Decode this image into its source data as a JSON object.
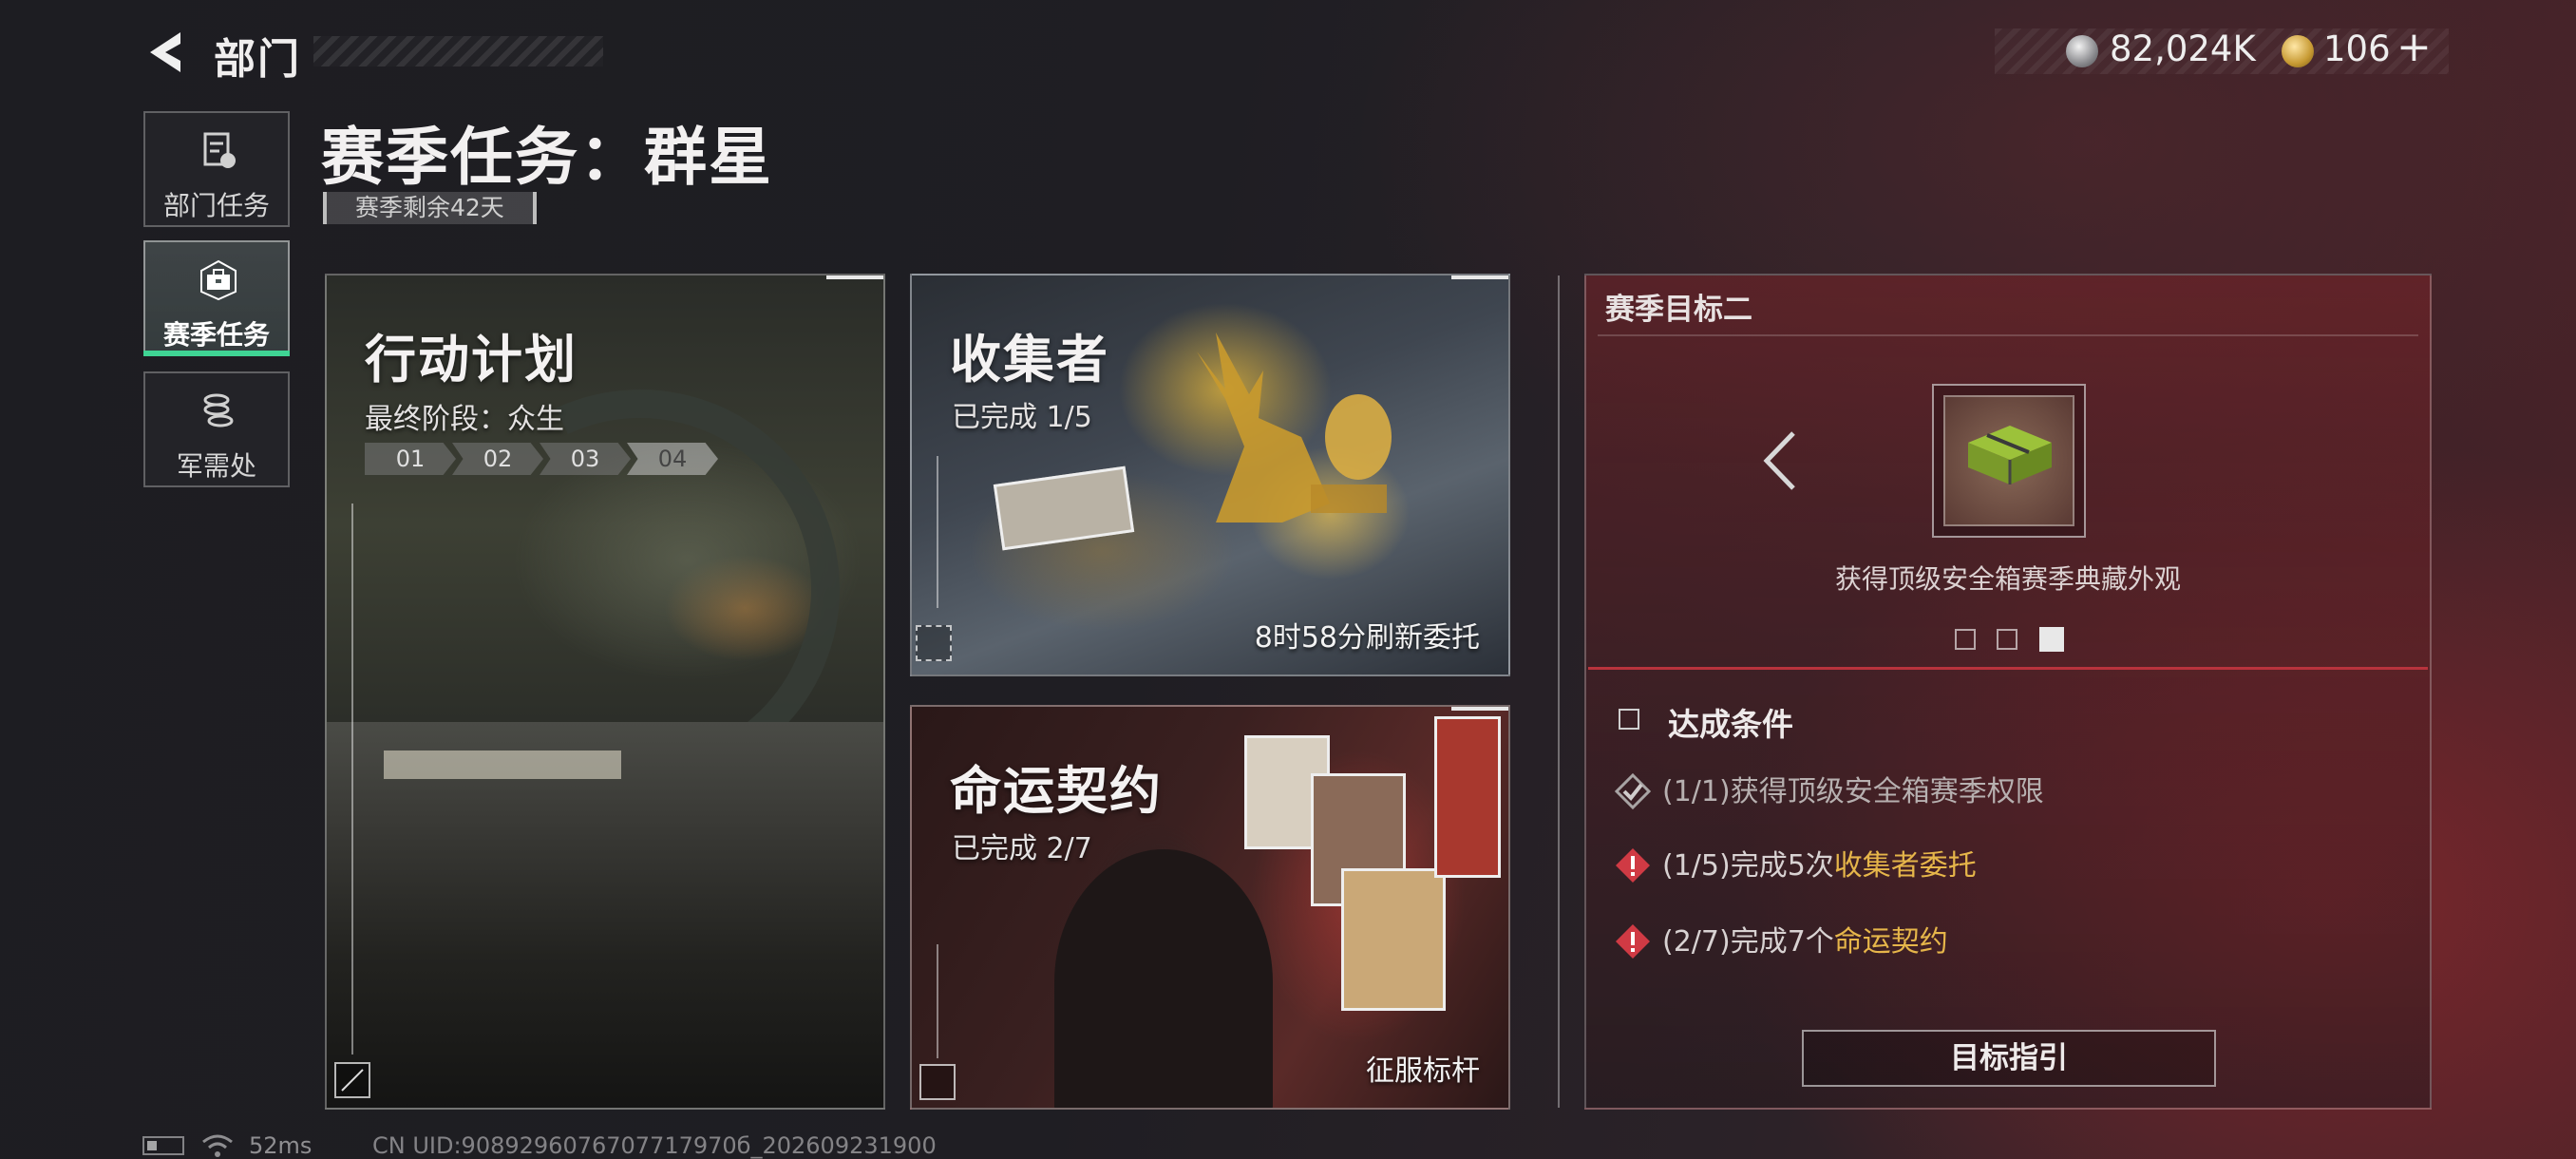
{
  "header": {
    "title": "部门",
    "currency": {
      "silver_value": "82,024K",
      "gold_value": "106",
      "plus": "+"
    }
  },
  "sidebar": {
    "items": [
      {
        "label": "部门任务",
        "icon": "clipboard-icon",
        "active": false
      },
      {
        "label": "赛季任务",
        "icon": "briefcase-icon",
        "active": true
      },
      {
        "label": "军需处",
        "icon": "coins-stack-icon",
        "active": false
      }
    ],
    "active_color": "#3fd494"
  },
  "page": {
    "title": "赛季任务：群星",
    "remaining": "赛季剩余42天"
  },
  "cards": {
    "action": {
      "title": "行动计划",
      "subtitle": "最终阶段：众生",
      "stages": [
        "01",
        "02",
        "03",
        "04"
      ]
    },
    "collector": {
      "title": "收集者",
      "subtitle": "已完成 1/5",
      "footer": "8时58分刷新委托"
    },
    "fate": {
      "title": "命运契约",
      "subtitle": "已完成 2/7",
      "footer": "征服标杆"
    }
  },
  "goal": {
    "title": "赛季目标二",
    "reward_caption": "获得顶级安全箱赛季典藏外观",
    "pager": {
      "count": 3,
      "active_index": 3
    },
    "conditions_title": "达成条件",
    "conditions": [
      {
        "status": "done",
        "text": "(1/1)获得顶级安全箱赛季权限",
        "highlight": ""
      },
      {
        "status": "pending",
        "text": "(1/5)完成5次",
        "highlight": "收集者委托"
      },
      {
        "status": "pending",
        "text": "(2/7)完成7个",
        "highlight": "命运契约"
      }
    ],
    "guide_button": "目标指引",
    "highlight_color": "#e6b64a",
    "warning_color": "#d03a44"
  },
  "status_bar": {
    "ping": "52ms",
    "uid": "CN UID:9089296076707717970б_202609231900"
  }
}
